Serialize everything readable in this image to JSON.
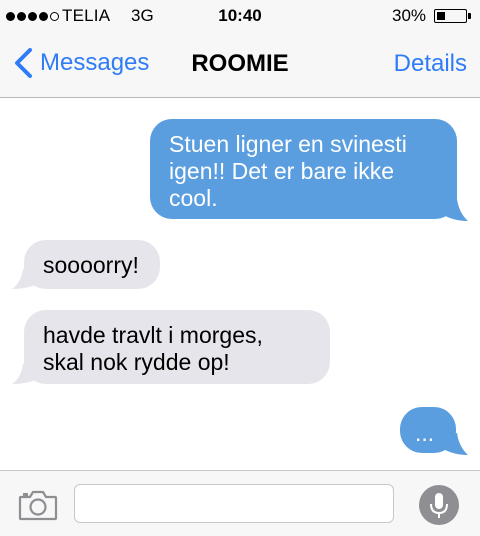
{
  "status_bar": {
    "carrier": "TELIA",
    "network": "3G",
    "time": "10:40",
    "battery_percent": "30%",
    "battery_level": 0.3,
    "signal_strength": 4,
    "signal_max": 5
  },
  "nav": {
    "back_label": "Messages",
    "title": "ROOMIE",
    "details_label": "Details"
  },
  "messages": [
    {
      "direction": "outgoing",
      "text": "Stuen ligner en svinesti\nigen!! Det er bare ikke\ncool."
    },
    {
      "direction": "incoming",
      "text": "soooorry!"
    },
    {
      "direction": "incoming",
      "text": "havde travlt i morges,\nskal nok rydde op!"
    },
    {
      "direction": "outgoing",
      "text": "..."
    }
  ],
  "input": {
    "value": "",
    "placeholder": ""
  },
  "icons": {
    "back": "chevron-left-icon",
    "camera": "camera-icon",
    "mic": "microphone-icon"
  },
  "colors": {
    "accent": "#2f7cf6",
    "outgoing_bubble": "#5a9ee0",
    "incoming_bubble": "#e6e5eb",
    "bar_background": "#f7f7f7"
  }
}
